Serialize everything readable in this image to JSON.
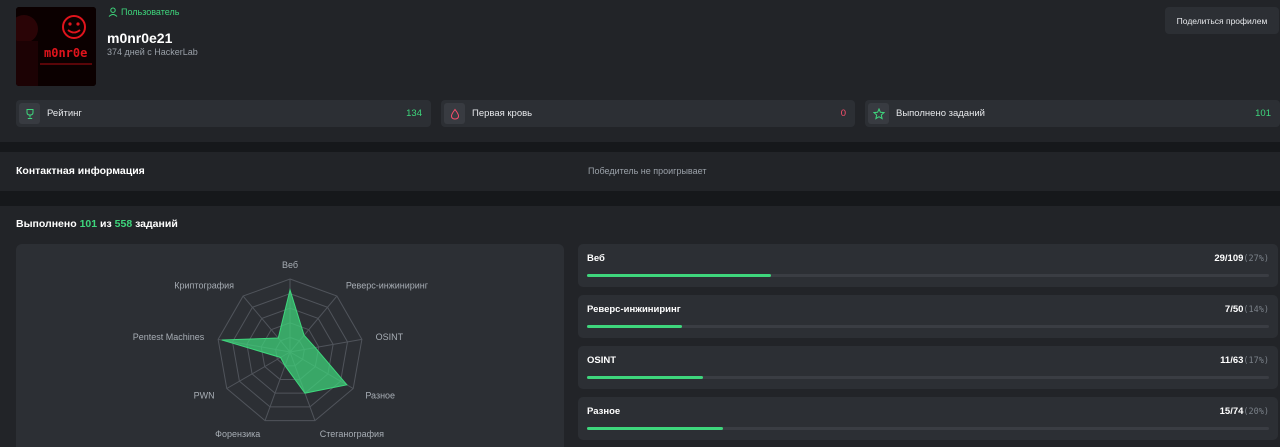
{
  "profile": {
    "role": "Пользователь",
    "username": "m0nr0e21",
    "days": "374 дней с HackerLab",
    "share_label": "Поделиться профилем",
    "avatar_text": "m0nr0e"
  },
  "stats": [
    {
      "label": "Рейтинг",
      "value": "134",
      "icon": "trophy-icon",
      "color": "#3ed67c"
    },
    {
      "label": "Первая кровь",
      "value": "0",
      "icon": "blood-drop-icon",
      "color": "#ff4f6d"
    },
    {
      "label": "Выполнено заданий",
      "value": "101",
      "icon": "star-icon",
      "color": "#3ed67c"
    }
  ],
  "contact": {
    "title": "Контактная информация",
    "motto": "Победитель не проигрывает"
  },
  "tasks": {
    "prefix": "Выполнено",
    "done": "101",
    "middle": "из",
    "total": "558",
    "suffix": "заданий"
  },
  "radar": {
    "axes": [
      "Веб",
      "Реверс-инжиниринг",
      "OSINT",
      "Разное",
      "Стеганография",
      "Форензика",
      "PWN",
      "Pentest Machines",
      "Криптография"
    ],
    "levels": 5,
    "values": [
      0.85,
      0.3,
      0.35,
      0.9,
      0.6,
      0.2,
      0.15,
      0.95,
      0.25
    ],
    "accent": "#3ed67c"
  },
  "categories": [
    {
      "name": "Веб",
      "count": "29/109",
      "pct": "(27%)",
      "progress": 0.27
    },
    {
      "name": "Реверс-инжиниринг",
      "count": "7/50",
      "pct": "(14%)",
      "progress": 0.14
    },
    {
      "name": "OSINT",
      "count": "11/63",
      "pct": "(17%)",
      "progress": 0.17
    },
    {
      "name": "Разное",
      "count": "15/74",
      "pct": "(20%)",
      "progress": 0.2
    }
  ]
}
